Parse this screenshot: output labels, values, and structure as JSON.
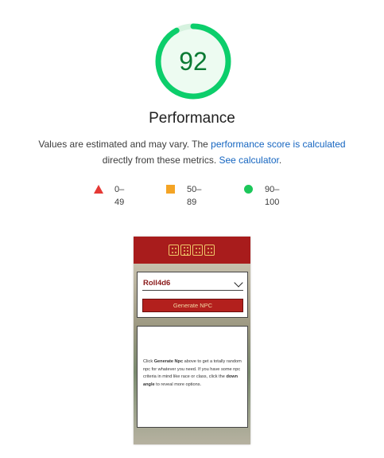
{
  "score": {
    "value": "92",
    "fraction": 0.92,
    "color": "#0cce6b",
    "track_color": "#e6f7ec",
    "fill_color": "#edfbf1"
  },
  "title": "Performance",
  "description": {
    "part1": "Values are estimated and may vary. The ",
    "link1": "performance score is calculated",
    "part2": " directly from these metrics. ",
    "link2": "See calculator",
    "part3": "."
  },
  "legend": [
    {
      "icon": "triangle-icon",
      "label": "0–49",
      "color": "#e53935"
    },
    {
      "icon": "square-icon",
      "label": "50–89",
      "color": "#f4a425"
    },
    {
      "icon": "circle-icon",
      "label": "90–100",
      "color": "#1cc75a"
    }
  ],
  "screenshot": {
    "header_color": "#a81c1c",
    "logo_icon": "dice-logo-icon",
    "select_value": "Roll4d6",
    "select_icon": "chevron-down-icon",
    "generate_label": "Generate NPC",
    "instructions": {
      "t1": "Click ",
      "b1": "Generate Npc",
      "t2": " above to get a totally random npc for whatever you need. If you have some npc criteria in mind like race or class, click the ",
      "b2": "down angle",
      "t3": " to reveal more options."
    }
  }
}
